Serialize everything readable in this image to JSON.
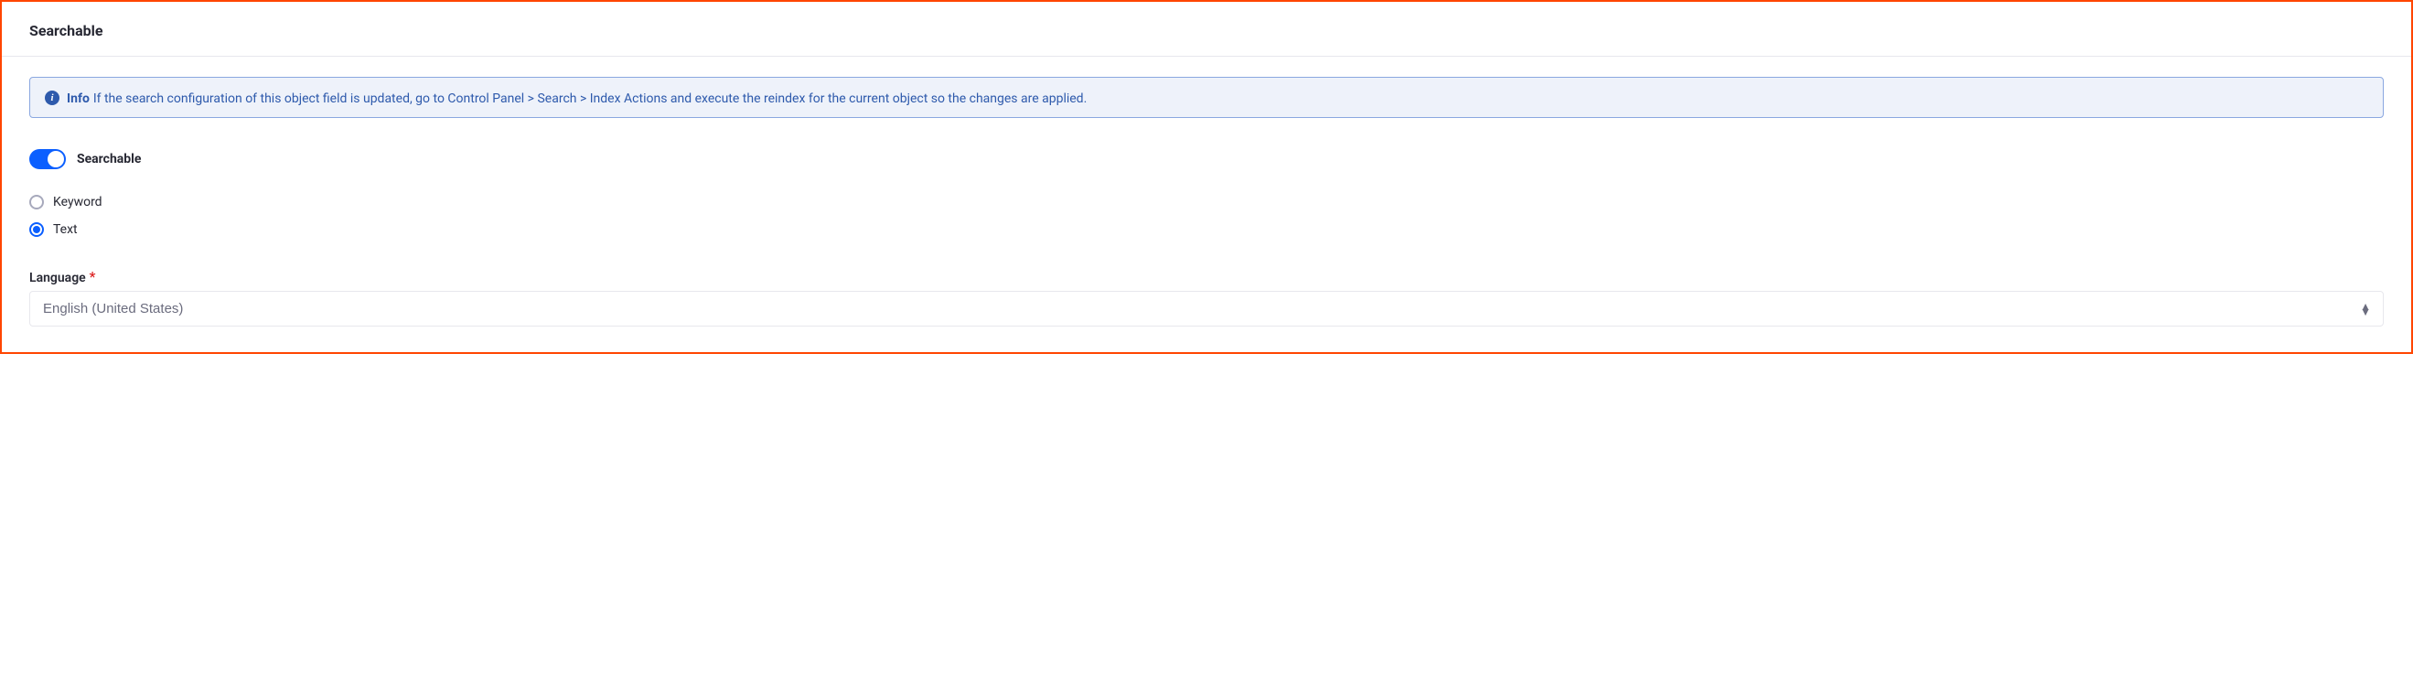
{
  "panel": {
    "title": "Searchable"
  },
  "alert": {
    "label": "Info",
    "message": "If the search configuration of this object field is updated, go to Control Panel > Search > Index Actions and execute the reindex for the current object so the changes are applied."
  },
  "toggle": {
    "label": "Searchable"
  },
  "radio": {
    "options": [
      {
        "label": "Keyword"
      },
      {
        "label": "Text"
      }
    ]
  },
  "language": {
    "label": "Language",
    "required_mark": "*",
    "value": "English (United States)"
  }
}
